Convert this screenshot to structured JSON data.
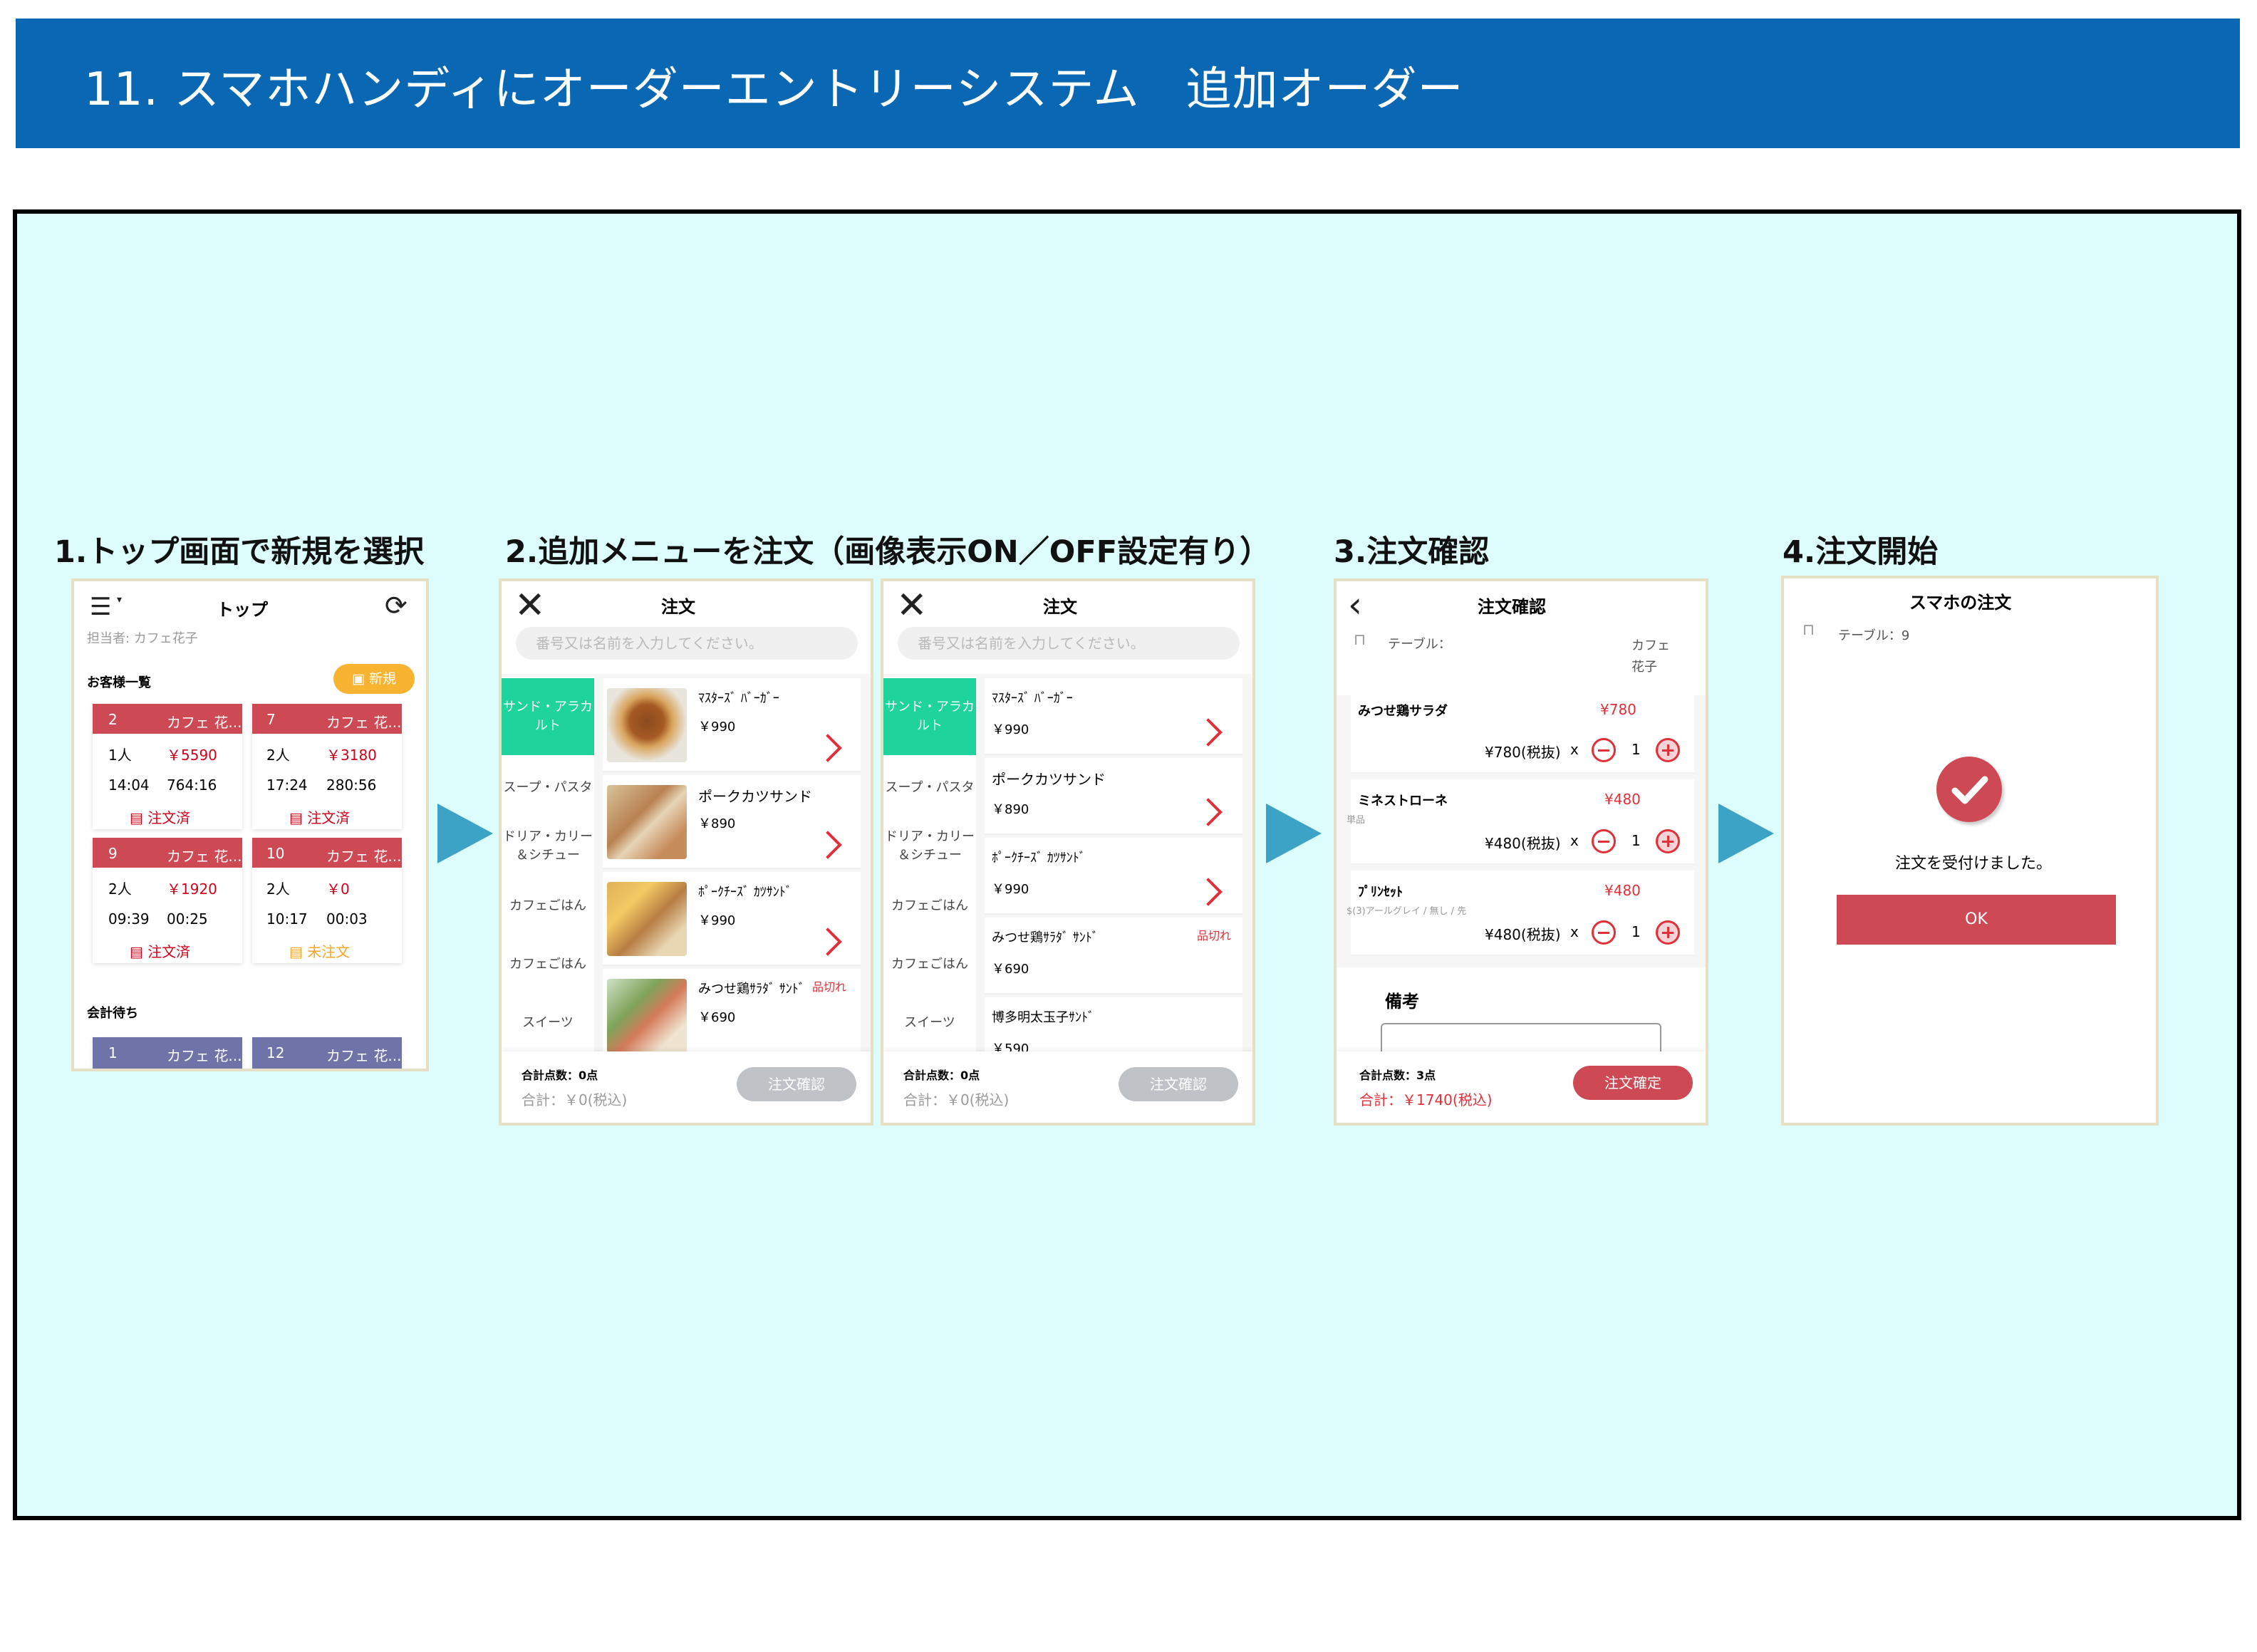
{
  "header": {
    "title": "11. スマホハンディにオーダーエントリーシステム　追加オーダー"
  },
  "steps": {
    "s1": "1.トップ画面で新規を選択",
    "s2": "2.追加メニューを注文（画像表示ON／OFF設定有り）",
    "s3": "3.注文確認",
    "s4": "4.注文開始"
  },
  "top": {
    "title": "トップ",
    "staff": "担当者: カフェ花子",
    "section_customers": "お客様一覧",
    "new_button": "新規",
    "section_checkout": "会計待ち",
    "cards": [
      {
        "no": "2",
        "name": "カフェ 花...",
        "people": "1人",
        "amount": "￥5590",
        "time": "14:04",
        "elapsed": "764:16",
        "status": "注文済"
      },
      {
        "no": "7",
        "name": "カフェ 花...",
        "people": "2人",
        "amount": "￥3180",
        "time": "17:24",
        "elapsed": "280:56",
        "status": "注文済"
      },
      {
        "no": "9",
        "name": "カフェ 花...",
        "people": "2人",
        "amount": "￥1920",
        "time": "09:39",
        "elapsed": "00:25",
        "status": "注文済"
      },
      {
        "no": "10",
        "name": "カフェ 花...",
        "people": "2人",
        "amount": "￥0",
        "time": "10:17",
        "elapsed": "00:03",
        "status": "未注文"
      }
    ],
    "checkout_cards": [
      {
        "no": "1",
        "name": "カフェ 花..."
      },
      {
        "no": "12",
        "name": "カフェ 花..."
      }
    ]
  },
  "order": {
    "title": "注文",
    "search_placeholder": "番号又は名前を入力してください。",
    "categories": [
      "サンド・アラカルト",
      "スープ・パスタ",
      "ドリア・カリー＆シチュー",
      "カフェごはん",
      "カフェごはん",
      "スイーツ"
    ],
    "items_with_image": [
      {
        "name": "ﾏｽﾀｰｽﾞ ﾊﾞｰｶﾞｰ",
        "price": "￥990",
        "soldout": ""
      },
      {
        "name": "ポークカツサンド",
        "price": "￥890",
        "soldout": ""
      },
      {
        "name": "ﾎﾟｰｸﾁｰｽﾞ ｶﾂｻﾝﾄﾞ",
        "price": "￥990",
        "soldout": ""
      },
      {
        "name": "みつせ鶏ｻﾗﾀﾞ ｻﾝﾄﾞ",
        "price": "￥690",
        "soldout": "品切れ"
      }
    ],
    "items_no_image": [
      {
        "name": "ﾏｽﾀｰｽﾞ ﾊﾞｰｶﾞｰ",
        "price": "￥990",
        "soldout": ""
      },
      {
        "name": "ポークカツサンド",
        "price": "￥890",
        "soldout": ""
      },
      {
        "name": "ﾎﾟｰｸﾁｰｽﾞ ｶﾂｻﾝﾄﾞ",
        "price": "￥990",
        "soldout": ""
      },
      {
        "name": "みつせ鶏ｻﾗﾀﾞ ｻﾝﾄﾞ",
        "price": "￥690",
        "soldout": "品切れ"
      },
      {
        "name": "博多明太玉子ｻﾝﾄﾞ",
        "price": "￥590",
        "soldout": ""
      }
    ],
    "total_count": "合計点数：0点",
    "total_price": "合計：￥0(税込)",
    "confirm_button": "注文確認"
  },
  "confirm": {
    "title": "注文確認",
    "table_label": "テーブル：",
    "customer": "カフェ 花子",
    "lines": [
      {
        "name": "みつせ鶏サラダ",
        "note": "",
        "price": "¥780",
        "subtotal": "¥780(税抜)",
        "qty": "1"
      },
      {
        "name": "ミネストローネ",
        "note": "単品",
        "price": "¥480",
        "subtotal": "¥480(税抜)",
        "qty": "1"
      },
      {
        "name": "ﾌﾟﾘﾝｾｯﾄ",
        "note": "$(3)アールグレイ / 無し / 先",
        "price": "¥480",
        "subtotal": "¥480(税抜)",
        "qty": "1"
      }
    ],
    "x": "x",
    "remarks_label": "備考",
    "total_count": "合計点数：3点",
    "total_price": "合計：￥1740(税込)",
    "submit_button": "注文確定"
  },
  "done": {
    "title": "スマホの注文",
    "table_label": "テーブル：9",
    "message": "注文を受付けました。",
    "ok_button": "OK"
  },
  "colors": {
    "header": "#0a67b3",
    "board": "#ddfdfd",
    "accent_red": "#cd4a55",
    "teal": "#1fd39d",
    "arrow": "#3ca3c7",
    "checkout": "#6f73a8"
  }
}
